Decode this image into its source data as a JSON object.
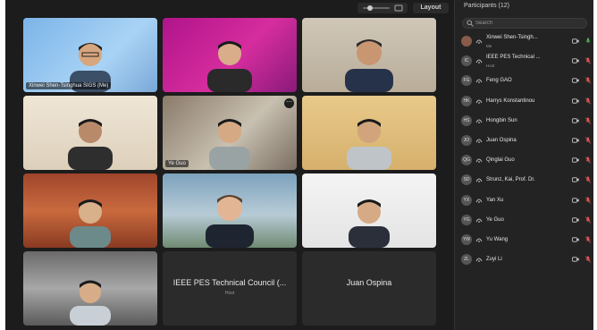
{
  "toolbar": {
    "layout_label": "Layout"
  },
  "panel": {
    "title": "Participants (12)",
    "search_placeholder": "Search"
  },
  "tiles": [
    {
      "name": "Xinwei Shen-Tsinghua SIGS (Me)"
    },
    {
      "name": ""
    },
    {
      "name": ""
    },
    {
      "name": ""
    },
    {
      "name": "Ye Guo"
    },
    {
      "name": ""
    },
    {
      "name": ""
    },
    {
      "name": ""
    },
    {
      "name": ""
    },
    {
      "name": ""
    },
    {
      "name": "IEEE PES Technical Council (...",
      "sub": "Host"
    },
    {
      "name": "Juan Ospina"
    }
  ],
  "participants": [
    {
      "initials": "",
      "name": "Xinwei Shen-Tsingh...",
      "role": "Me",
      "mic": "on"
    },
    {
      "initials": "IC",
      "name": "IEEE PES Technical ...",
      "role": "Host",
      "mic": "off"
    },
    {
      "initials": "FG",
      "name": "Feng GAO",
      "role": "",
      "mic": "off"
    },
    {
      "initials": "HK",
      "name": "Harrys Konstantinou",
      "role": "",
      "mic": "off"
    },
    {
      "initials": "HS",
      "name": "Hongbin Sun",
      "role": "",
      "mic": "off"
    },
    {
      "initials": "JO",
      "name": "Juan Ospina",
      "role": "",
      "mic": "off"
    },
    {
      "initials": "QG",
      "name": "Qinglai Guo",
      "role": "",
      "mic": "off"
    },
    {
      "initials": "SD",
      "name": "Strunz, Kai, Prof. Dr.",
      "role": "",
      "mic": "off"
    },
    {
      "initials": "YX",
      "name": "Yan Xu",
      "role": "",
      "mic": "off"
    },
    {
      "initials": "YG",
      "name": "Ye Guo",
      "role": "",
      "mic": "off"
    },
    {
      "initials": "YW",
      "name": "Yu Wang",
      "role": "",
      "mic": "off"
    },
    {
      "initials": "ZL",
      "name": "Zuyi Li",
      "role": "",
      "mic": "off"
    }
  ],
  "colors": {
    "accent": "#5aa0ff",
    "muted": "#e0564d",
    "unmuted": "#4caf50",
    "panel": "#232323",
    "stage": "#1c1c1c"
  }
}
